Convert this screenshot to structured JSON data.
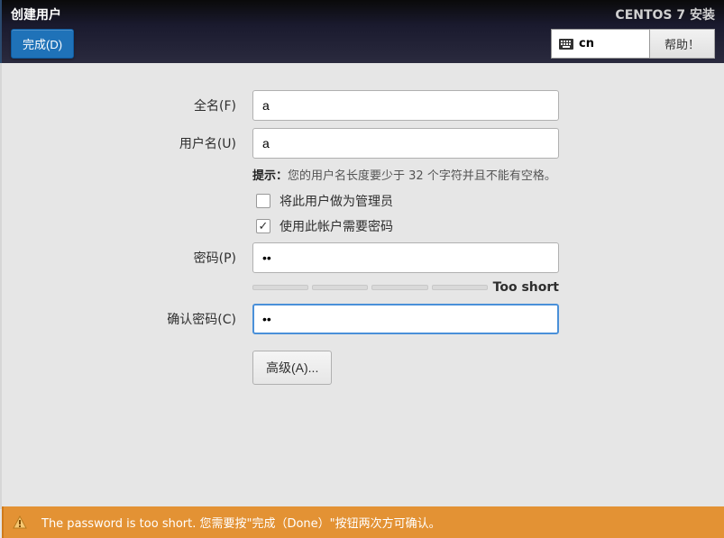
{
  "header": {
    "title": "创建用户",
    "done_label": "完成(D)",
    "subtitle": "CENTOS 7 安装",
    "keyboard": "cn",
    "help_label": "帮助！"
  },
  "form": {
    "fullname_label": "全名(F)",
    "fullname_value": "a",
    "username_label": "用户名(U)",
    "username_value": "a",
    "hint_label": "提示：",
    "hint_text": "您的用户名长度要少于 32 个字符并且不能有空格。",
    "checkbox_admin": "将此用户做为管理员",
    "checkbox_require_password": "使用此帐户需要密码",
    "password_label": "密码(P)",
    "password_value": "••",
    "strength_label": "Too short",
    "confirm_label": "确认密码(C)",
    "confirm_value": "••",
    "advanced_label": "高级(A)..."
  },
  "warning": {
    "text": "The password is too short. 您需要按\"完成（Done）\"按钮两次方可确认。"
  }
}
